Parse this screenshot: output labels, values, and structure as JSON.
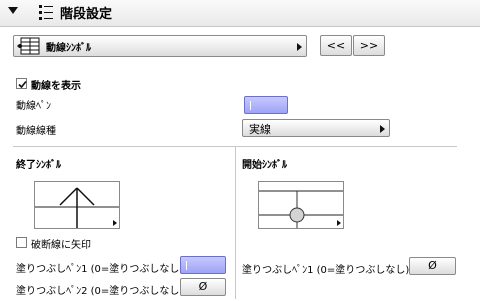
{
  "header": {
    "title": "階段設定"
  },
  "symbol_selector": {
    "label": "動線ｼﾝﾎﾞﾙ",
    "prev": "<<",
    "next": ">>"
  },
  "show_line": {
    "label": "動線を表示",
    "checked": true
  },
  "line_pen": {
    "label": "動線ﾍﾟﾝ",
    "color": "#a3a6f5"
  },
  "line_type": {
    "label": "動線線種",
    "value": "実線"
  },
  "end_symbol": {
    "title": "終了ｼﾝﾎﾞﾙ",
    "arrow_checkbox": "破断線に矢印",
    "fill_pen1_label": "塗りつぶしﾍﾟﾝ1 (0=塗りつぶしなし)",
    "fill_pen1_color": "#a3a6f5",
    "fill_pen2_label": "塗りつぶしﾍﾟﾝ2 (0=塗りつぶしなし)",
    "fill_pen2_value": "Ø"
  },
  "start_symbol": {
    "title": "開始ｼﾝﾎﾞﾙ",
    "fill_pen1_label": "塗りつぶしﾍﾟﾝ1 (0=塗りつぶしなし)",
    "fill_pen1_value": "Ø"
  }
}
